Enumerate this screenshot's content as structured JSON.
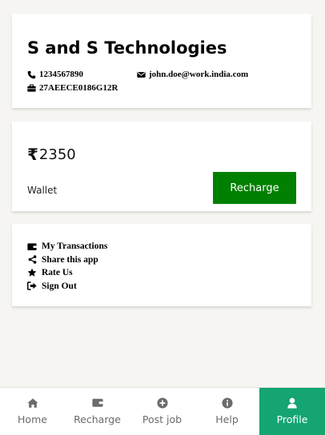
{
  "company": {
    "name": "S and S Technologies",
    "phone": "1234567890",
    "email": "john.doe@work.india.com",
    "gst": "27AEECE0186G12R",
    "phone_icon": "phone-icon",
    "email_icon": "envelope-icon",
    "gst_icon": "briefcase-icon"
  },
  "wallet": {
    "currency_symbol": "₹",
    "amount": "2350",
    "label": "Wallet",
    "recharge_label": "Recharge",
    "recharge_color": "#008000"
  },
  "menu": {
    "items": [
      {
        "label": "My Transactions",
        "icon": "wallet-icon"
      },
      {
        "label": "Share this app",
        "icon": "share-icon"
      },
      {
        "label": "Rate Us",
        "icon": "star-icon"
      },
      {
        "label": "Sign Out",
        "icon": "sign-out-icon"
      }
    ]
  },
  "nav": {
    "active_color": "#14a573",
    "items": [
      {
        "label": "Home",
        "icon": "home-icon",
        "active": false
      },
      {
        "label": "Recharge",
        "icon": "wallet-icon",
        "active": false
      },
      {
        "label": "Post job",
        "icon": "plus-circle-icon",
        "active": false
      },
      {
        "label": "Help",
        "icon": "info-circle-icon",
        "active": false
      },
      {
        "label": "Profile",
        "icon": "user-icon",
        "active": true
      }
    ]
  }
}
